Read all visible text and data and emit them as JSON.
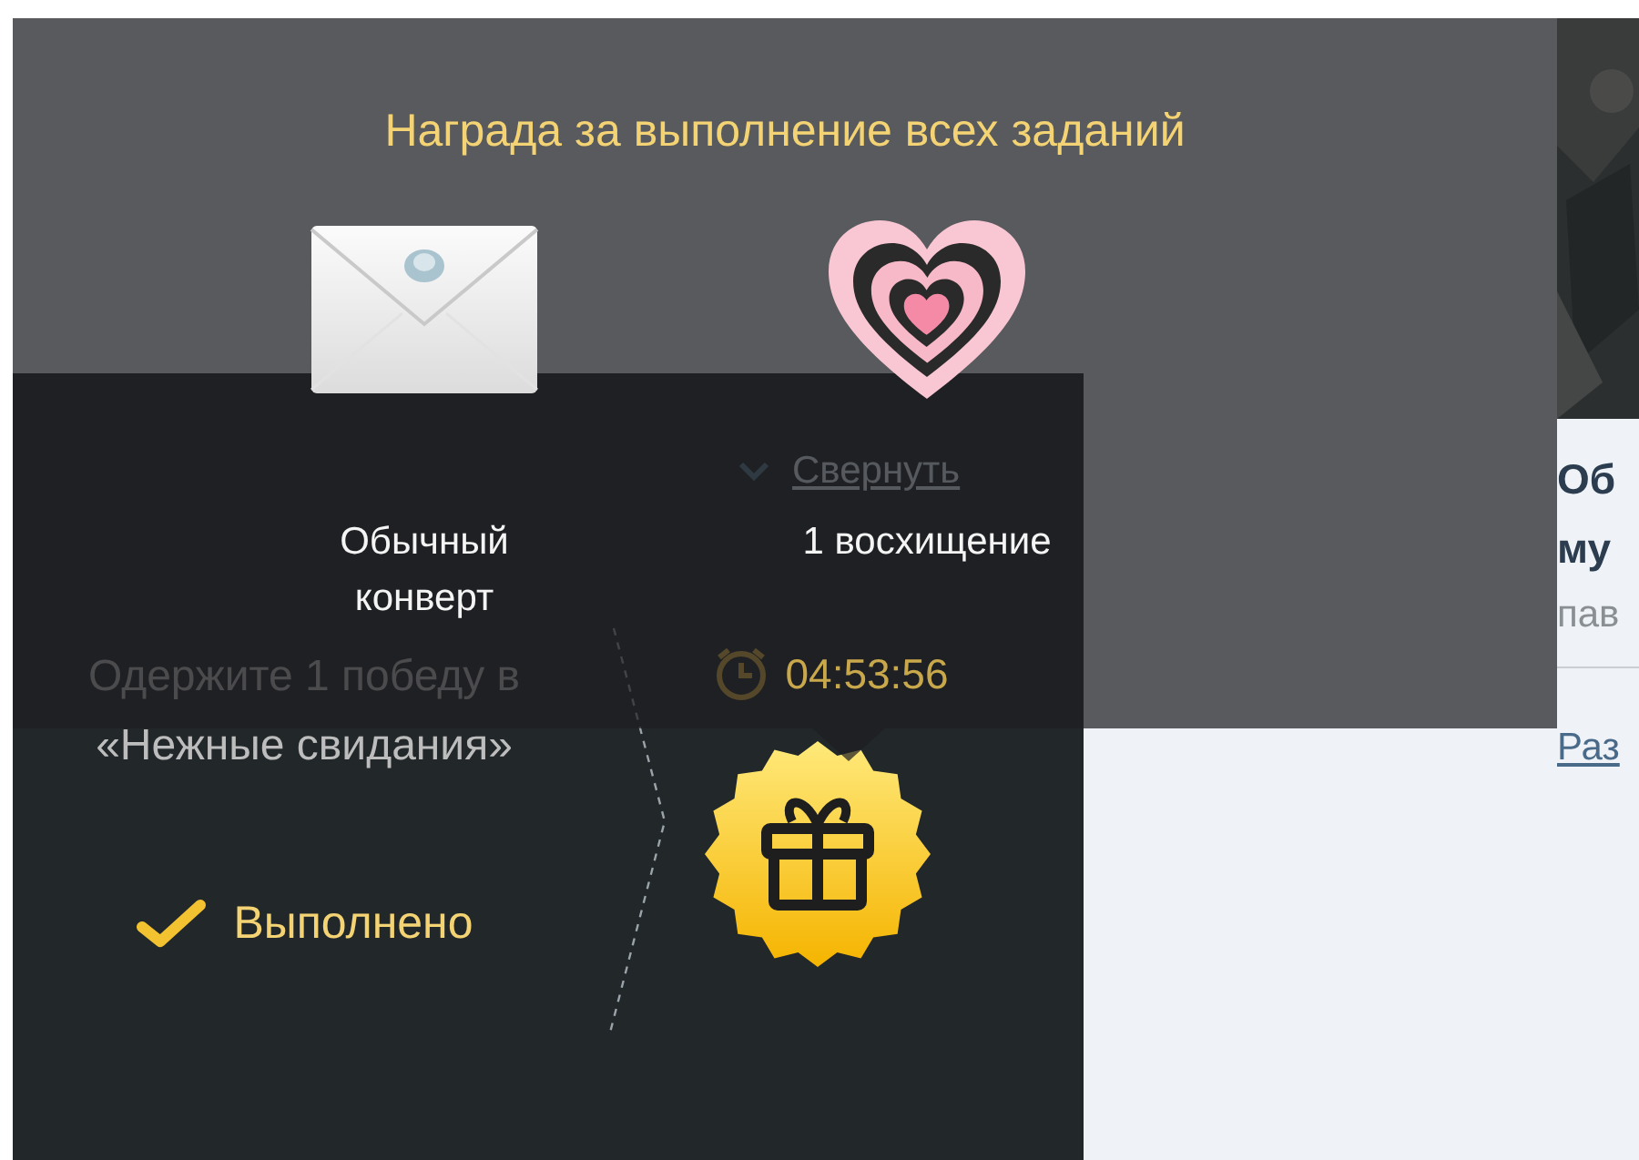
{
  "reward_tooltip": {
    "title": "Награда за выполнение всех заданий",
    "rewards": [
      {
        "kind": "envelope",
        "label": "Обычный конверт"
      },
      {
        "kind": "heart",
        "label": "1 восхищение"
      }
    ]
  },
  "collapse_link": "Свернуть",
  "task": {
    "description": "Одержите 1 победу в «Нежные свидания»",
    "timer": "04:53:56",
    "status": "Выполнено",
    "completed": true
  },
  "side_article": {
    "title_lines": [
      "Об",
      "му"
    ],
    "meta": "пав",
    "link": "Раз"
  }
}
